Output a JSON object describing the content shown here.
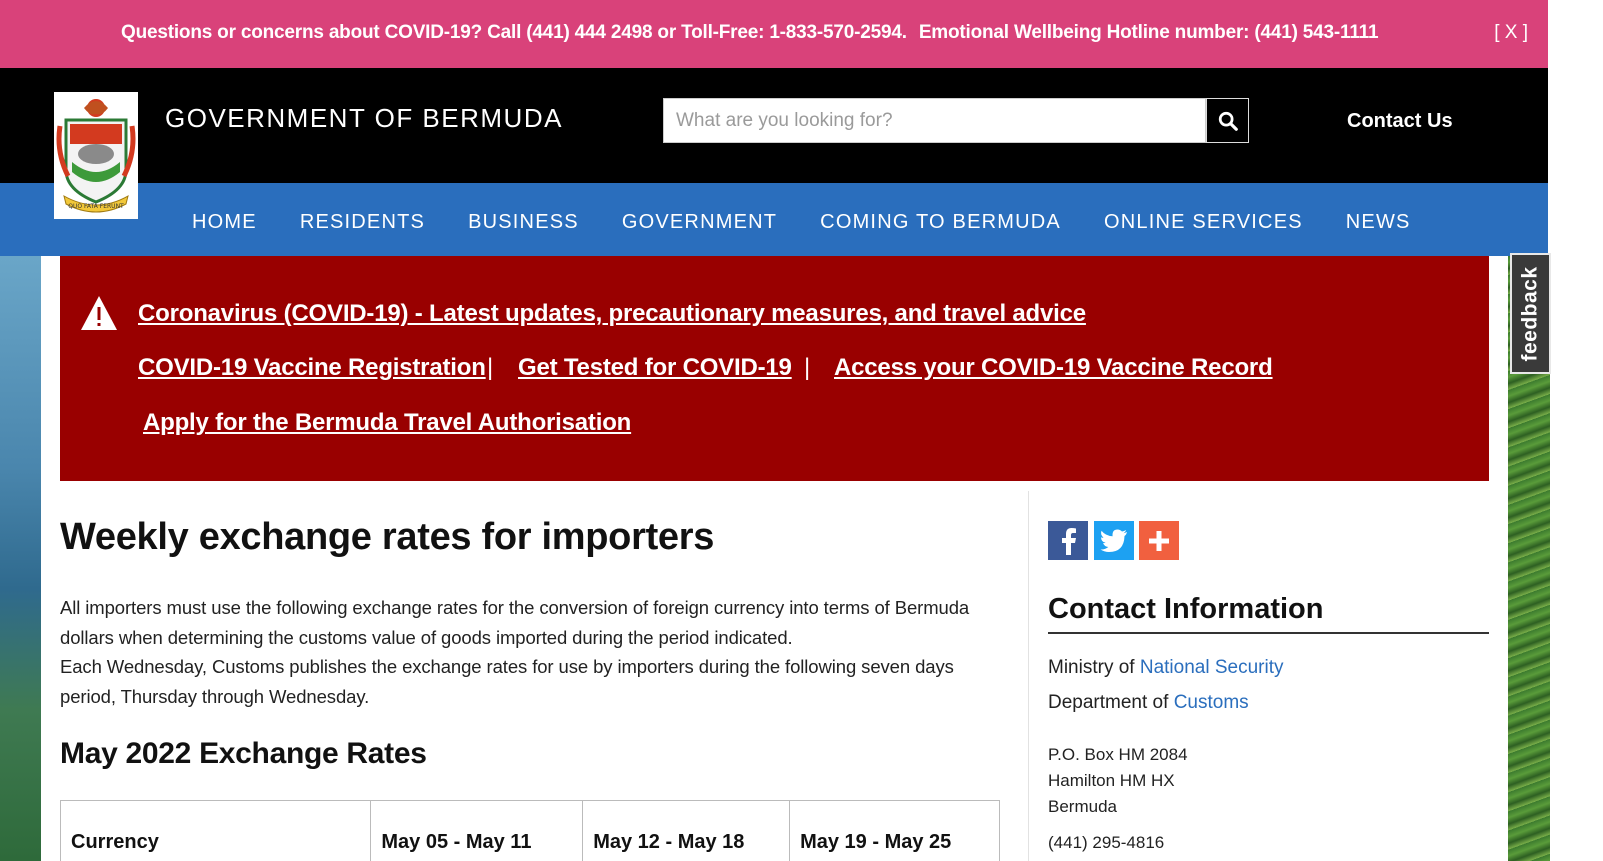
{
  "announcement": {
    "covid_line": "Questions or concerns about COVID-19? Call (441) 444 2498 or Toll-Free: 1-833-570-2594.",
    "wellbeing_line": "Emotional Wellbeing Hotline number: (441) 543-1111",
    "close_label": "[ X ]"
  },
  "header": {
    "site_title": "GOVERNMENT OF BERMUDA",
    "search_placeholder": "What are you looking for?",
    "search_icon": "search-icon",
    "contact_label": "Contact Us",
    "crest_motto": "QUO FATA FERUNT"
  },
  "nav": {
    "items": [
      "HOME",
      "RESIDENTS",
      "BUSINESS",
      "GOVERNMENT",
      "COMING TO BERMUDA",
      "ONLINE SERVICES",
      "NEWS"
    ]
  },
  "alert": {
    "icon": "warning-triangle-icon",
    "headline": "Coronavirus (COVID-19) - Latest updates, precautionary measures, and travel advice",
    "links": [
      "COVID-19 Vaccine Registration",
      "Get Tested for COVID-19",
      "Access your COVID-19 Vaccine Record"
    ],
    "separator": "|",
    "travel_link": "Apply for the Bermuda Travel Authorisation"
  },
  "main": {
    "title": "Weekly exchange rates for importers",
    "intro_1": "All importers must use the following exchange rates for the conversion of foreign currency into terms of Bermuda dollars when determining the customs value of goods imported during the period indicated.",
    "intro_2": "Each Wednesday, Customs publishes the exchange rates for use by importers during the following seven days period, Thursday through Wednesday.",
    "subtitle": "May 2022 Exchange Rates",
    "table_headers": [
      "Currency",
      "May 05 - May 11",
      "May 12 - May 18",
      "May 19 - May 25"
    ]
  },
  "sidebar": {
    "share_icons": [
      "facebook-icon",
      "twitter-icon",
      "plus-icon"
    ],
    "title": "Contact Information",
    "ministry_prefix": "Ministry of",
    "ministry_link": "National Security",
    "department_prefix": "Department of",
    "department_link": "Customs",
    "address": [
      "P.O. Box HM 2084",
      "Hamilton HM HX",
      "Bermuda"
    ],
    "phone": "(441) 295-4816"
  },
  "feedback": {
    "label": "feedback"
  },
  "colors": {
    "announcement_bg": "#d9427a",
    "nav_bg": "#2a6ebd",
    "alert_bg": "#990000",
    "link": "#2a6ebd"
  }
}
